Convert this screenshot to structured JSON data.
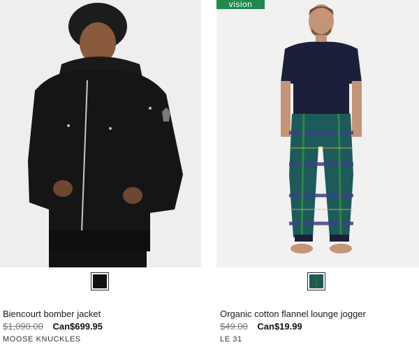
{
  "products": [
    {
      "title": "Biencourt bomber jacket",
      "original_price": "$1,090.00",
      "sale_price": "Can$699.95",
      "brand": "MOOSE KNUCKLES",
      "swatch_color": "#111111"
    },
    {
      "badge": "vision",
      "title": "Organic cotton flannel lounge jogger",
      "original_price": "$49.00",
      "sale_price": "Can$19.99",
      "brand": "LE 31",
      "swatch_color": "#1d5a5a"
    }
  ],
  "colors": {
    "badge_green": "#1f8a4c",
    "photo_bg": "#ececec"
  }
}
